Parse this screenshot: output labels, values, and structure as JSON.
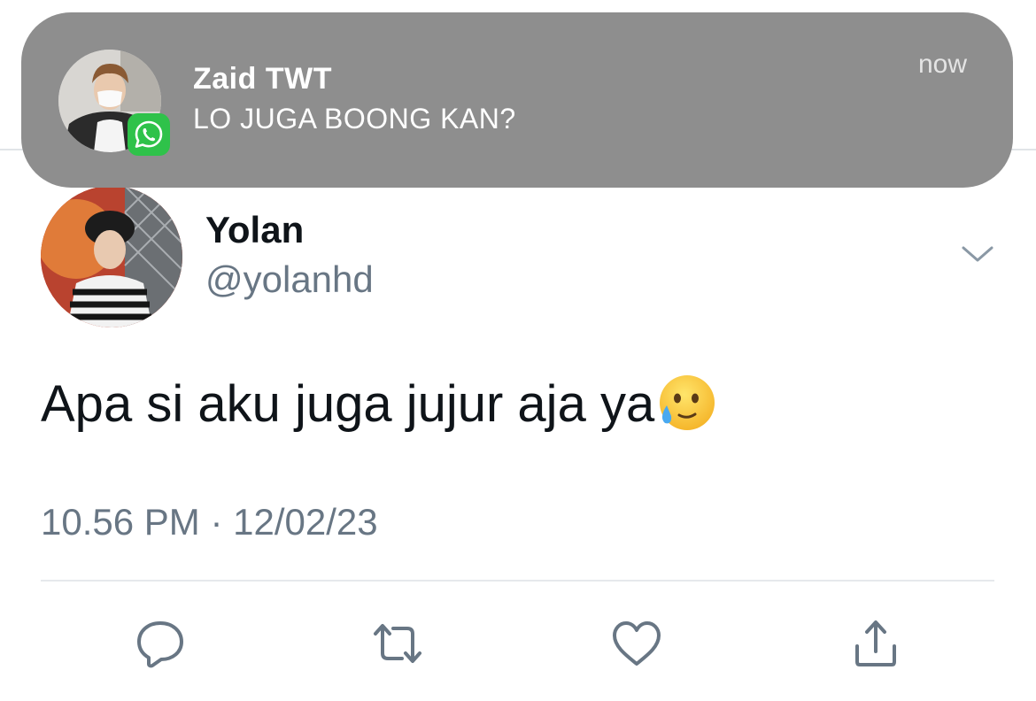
{
  "notification": {
    "sender": "Zaid TWT",
    "message": "LO JUGA BOONG KAN?",
    "time": "now",
    "app_icon": "whatsapp-icon",
    "background_color": "#8e8e8e"
  },
  "tweet": {
    "author_name": "Yolan",
    "author_handle": "@yolanhd",
    "text": "Apa si aku juga jujur aja ya",
    "emoji": "face-holding-back-tears-icon",
    "time": "10.56 PM",
    "separator": "·",
    "date": "12/02/23"
  },
  "actions": [
    {
      "name": "reply",
      "icon": "reply-icon"
    },
    {
      "name": "retweet",
      "icon": "retweet-icon"
    },
    {
      "name": "like",
      "icon": "heart-icon"
    },
    {
      "name": "share",
      "icon": "share-icon"
    }
  ],
  "colors": {
    "text_primary": "#0f1419",
    "text_secondary": "#687684",
    "icon_gray": "#687684",
    "whatsapp_green": "#2fc24a"
  }
}
